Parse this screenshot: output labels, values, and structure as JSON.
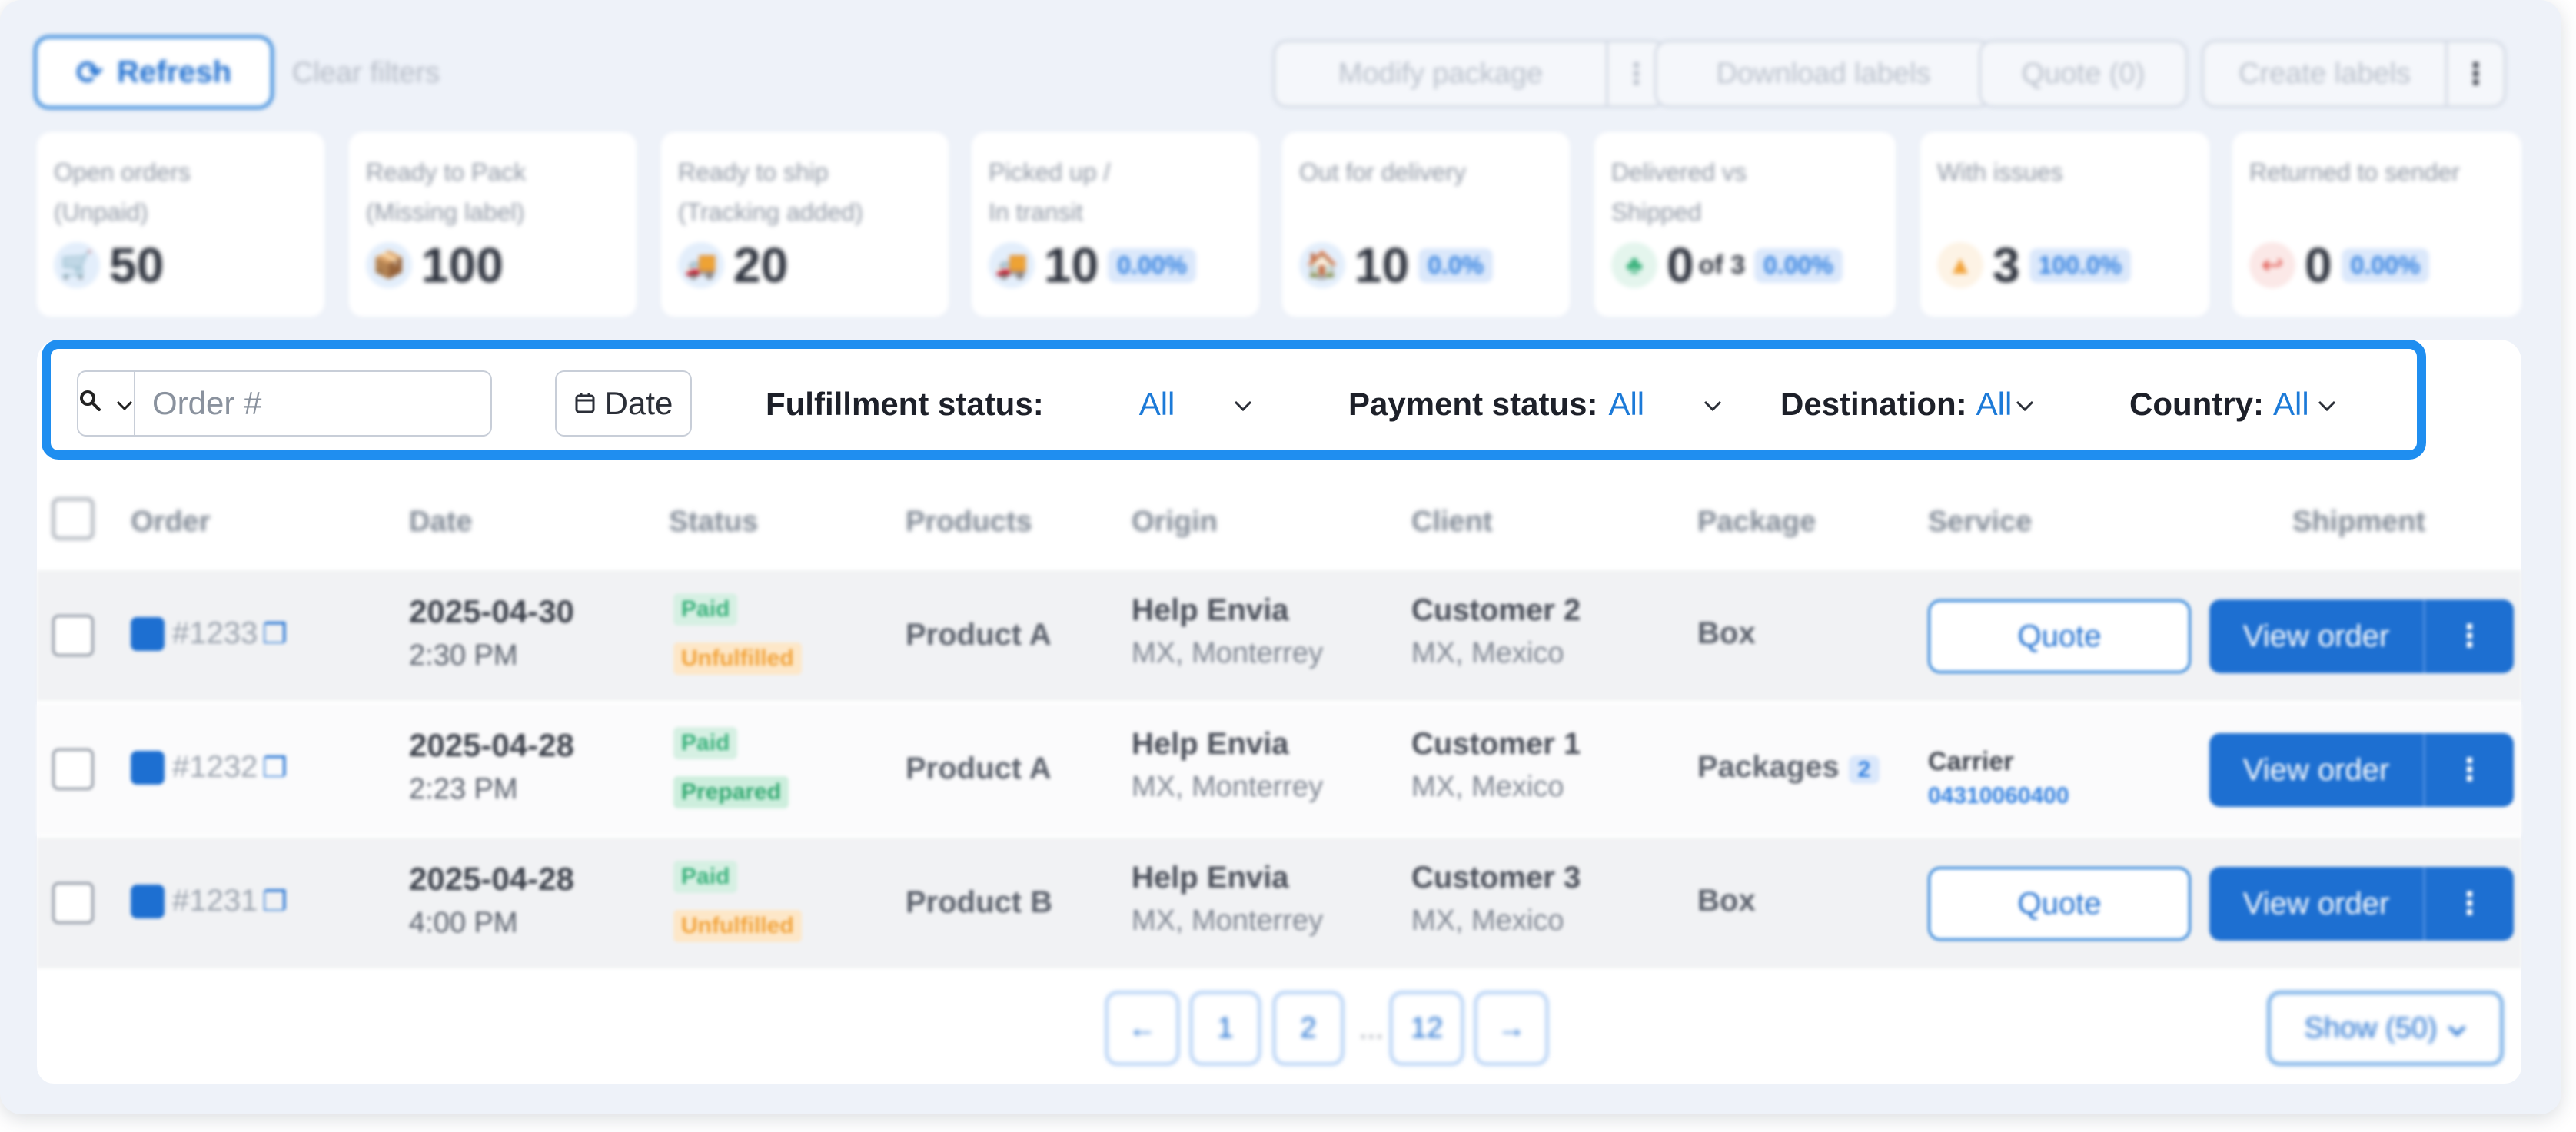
{
  "toolbar": {
    "refresh_label": "Refresh",
    "clear_filters_label": "Clear filters",
    "modify_package_label": "Modify package",
    "download_labels_label": "Download labels",
    "quote_label": "Quote (0)",
    "create_labels_label": "Create labels",
    "more_glyph": "⋮"
  },
  "kpis": [
    {
      "label_line1": "Open orders",
      "label_line2": "(Unpaid)",
      "value": "50",
      "of": "",
      "pct": "",
      "icon": "cart-icon",
      "icon_glyph": "🛒",
      "color": "#2f7fe0"
    },
    {
      "label_line1": "Ready to Pack",
      "label_line2": "(Missing label)",
      "value": "100",
      "of": "",
      "pct": "",
      "icon": "box-icon",
      "icon_glyph": "📦",
      "color": "#2f7fe0"
    },
    {
      "label_line1": "Ready to ship",
      "label_line2": "(Tracking added)",
      "value": "20",
      "of": "",
      "pct": "",
      "icon": "truck-icon",
      "icon_glyph": "🚚",
      "color": "#2f7fe0"
    },
    {
      "label_line1": "Picked up /",
      "label_line2": "In transit",
      "value": "10",
      "of": "",
      "pct": "0.00%",
      "icon": "transit-icon",
      "icon_glyph": "🚚",
      "color": "#2f7fe0"
    },
    {
      "label_line1": "Out for delivery",
      "label_line2": "",
      "value": "10",
      "of": "",
      "pct": "0.0%",
      "icon": "home-icon",
      "icon_glyph": "🏠",
      "color": "#2f7fe0"
    },
    {
      "label_line1": "Delivered vs",
      "label_line2": "Shipped",
      "value": "0",
      "of": "of 3",
      "pct": "0.00%",
      "icon": "delivered-icon",
      "icon_glyph": "♣",
      "color": "#37b17a"
    },
    {
      "label_line1": "With issues",
      "label_line2": "",
      "value": "3",
      "of": "",
      "pct": "100.0%",
      "icon": "warning-icon",
      "icon_glyph": "▲",
      "color": "#f2a33a"
    },
    {
      "label_line1": "Returned to sender",
      "label_line2": "",
      "value": "0",
      "of": "",
      "pct": "0.00%",
      "icon": "return-icon",
      "icon_glyph": "↩",
      "color": "#e0524b"
    }
  ],
  "filters": {
    "search_placeholder": "Order #",
    "date_label": "Date",
    "fulfillment_label": "Fulfillment status:",
    "fulfillment_value": "All",
    "payment_label": "Payment status:",
    "payment_value": "All",
    "destination_label": "Destination:",
    "destination_value": "All",
    "country_label": "Country:",
    "country_value": "All"
  },
  "table": {
    "headers": {
      "order": "Order",
      "date": "Date",
      "status": "Status",
      "products": "Products",
      "origin": "Origin",
      "client": "Client",
      "package": "Package",
      "service": "Service",
      "shipment": "Shipment"
    },
    "rows": [
      {
        "order": "#1233",
        "date": "2025-04-30",
        "time": "2:30 PM",
        "payment": "Paid",
        "fulfillment": "Unfulfilled",
        "fulfillment_kind": "unfulfilled",
        "product": "Product A",
        "origin_name": "Help Envia",
        "origin_loc": "MX, Monterrey",
        "client_name": "Customer 2",
        "client_loc": "MX, Mexico",
        "package": "Box",
        "package_count": "",
        "service_type": "quote",
        "service_quote": "Quote",
        "carrier": "",
        "tracking": "",
        "view_label": "View order"
      },
      {
        "order": "#1232",
        "date": "2025-04-28",
        "time": "2:23 PM",
        "payment": "Paid",
        "fulfillment": "Prepared",
        "fulfillment_kind": "prepared",
        "product": "Product A",
        "origin_name": "Help Envia",
        "origin_loc": "MX, Monterrey",
        "client_name": "Customer 1",
        "client_loc": "MX, Mexico",
        "package": "Packages",
        "package_count": "2",
        "service_type": "carrier",
        "service_quote": "",
        "carrier": "Carrier",
        "tracking": "04310060400",
        "view_label": "View order"
      },
      {
        "order": "#1231",
        "date": "2025-04-28",
        "time": "4:00 PM",
        "payment": "Paid",
        "fulfillment": "Unfulfilled",
        "fulfillment_kind": "unfulfilled",
        "product": "Product B",
        "origin_name": "Help Envia",
        "origin_loc": "MX, Monterrey",
        "client_name": "Customer 3",
        "client_loc": "MX, Mexico",
        "package": "Box",
        "package_count": "",
        "service_type": "quote",
        "service_quote": "Quote",
        "carrier": "",
        "tracking": "",
        "view_label": "View order"
      }
    ]
  },
  "pagination": {
    "prev": "←",
    "pages": [
      "1",
      "2",
      "12"
    ],
    "ellipsis": "...",
    "next": "→",
    "show_label": "Show (50)"
  }
}
